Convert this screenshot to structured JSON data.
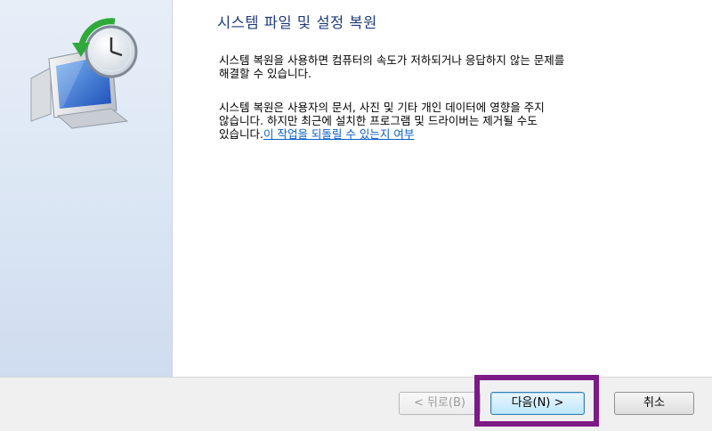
{
  "wizard": {
    "title": "시스템 파일 및 설정 복원",
    "paragraph1": [
      "시스템 복원을 사용하면 컴퓨터의 속도가 저하되거나 응답하지 않는 문제를",
      "해결할 수 있습니다."
    ],
    "paragraph2": [
      "시스템 복원은 사용자의 문서, 사진 및 기타 개인 데이터에 영향을 주지",
      "않습니다. 하지만 최근에 설치한 프로그램 및 드라이버는 제거될 수도"
    ],
    "paragraph2_last": "있습니다.",
    "link_text": "이 작업을 되돌릴 수 있는지 여부"
  },
  "footer": {
    "back_label": "< 뒤로(B)",
    "next_label": "다음(N) >",
    "cancel_label": "취소"
  },
  "icons": {
    "illustration": "system-restore-monitor-clock-icon"
  },
  "colors": {
    "title": "#1f3b7a",
    "link": "#0a5ec7",
    "highlight_border": "#7d1a85"
  }
}
